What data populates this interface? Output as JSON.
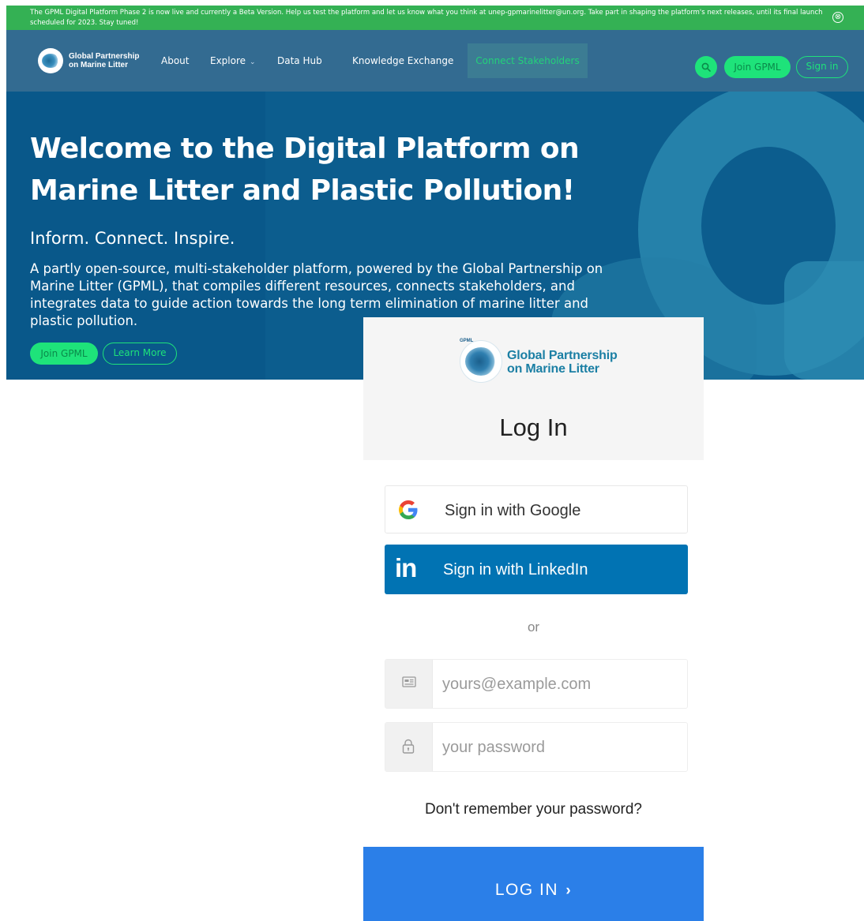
{
  "announcement": {
    "text": "The GPML Digital Platform Phase 2 is now live and currently a Beta Version. Help us test the platform and let us know what you think at unep-gpmarinelitter@un.org. Take part in shaping the platform's next releases, until its final launch scheduled for 2023. Stay tuned!",
    "close_icon": "⊗"
  },
  "nav": {
    "logo_text": "Global Partnership on Marine Litter",
    "items": [
      "About",
      "Explore",
      "Data Hub",
      "Knowledge Exchange",
      "Connect Stakeholders"
    ],
    "explore_chevron": "⌄",
    "join_label": "Join GPML",
    "signin_label": "Sign in"
  },
  "hero": {
    "title": "Welcome to the Digital Platform on Marine Litter and Plastic Pollution!",
    "subtitle": "Inform. Connect. Inspire.",
    "description": "A partly open-source, multi-stakeholder platform, powered by the Global Partnership on Marine Litter (GPML), that compiles different resources, connects stakeholders, and integrates data to guide action towards the long term elimination of marine litter and plastic pollution.",
    "join_label": "Join GPML",
    "learn_label": "Learn More"
  },
  "login": {
    "logo_badge": "GPML",
    "logo_name": "Global Partnership on Marine Litter",
    "title": "Log In",
    "google_label": "Sign in with Google",
    "linkedin_icon": "in",
    "linkedin_label": "Sign in with LinkedIn",
    "or_text": "or",
    "email_placeholder": "yours@example.com",
    "password_placeholder": "your password",
    "forgot_label": "Don't remember your password?",
    "submit_label": "LOG IN",
    "submit_chevron": "›"
  },
  "colors": {
    "announcement_bg": "#34b154",
    "nav_bg": "#336b91",
    "hero_bg": "#0c5d8e",
    "accent_green": "#1ee37a",
    "linkedin_blue": "#0173b3",
    "login_blue": "#2b7fe8"
  }
}
